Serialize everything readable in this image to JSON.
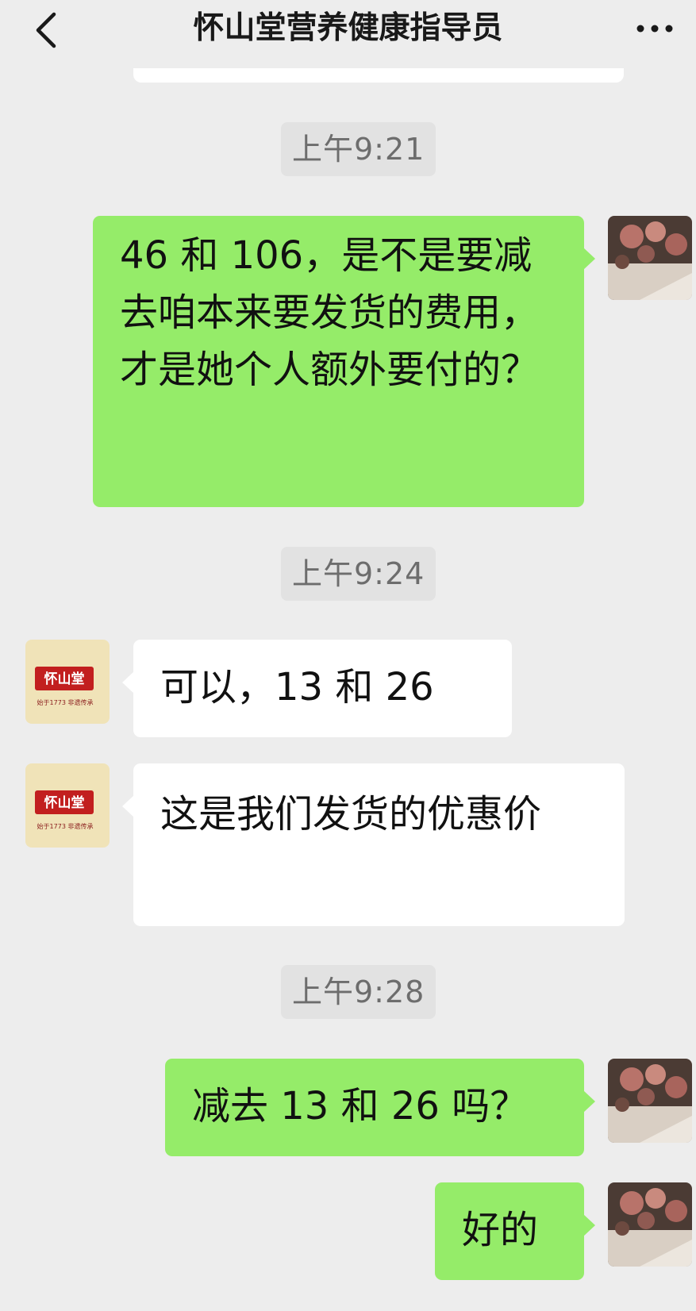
{
  "header": {
    "title": "怀山堂营养健康指导员",
    "back_icon": "chevron-left-icon",
    "more_icon": "more-dots-icon"
  },
  "messages": [
    {
      "type": "time",
      "text": "上午9:21"
    },
    {
      "type": "sent",
      "text": "46 和 106，是不是要减去咱本来要发货的费用，才是她个人额外要付的？"
    },
    {
      "type": "time",
      "text": "上午9:24"
    },
    {
      "type": "received",
      "text": "可以，13 和 26"
    },
    {
      "type": "received",
      "text": "这是我们发货的优惠价"
    },
    {
      "type": "time",
      "text": "上午9:28"
    },
    {
      "type": "sent",
      "text": "减去 13 和 26 吗？"
    },
    {
      "type": "sent",
      "text": "好的"
    }
  ],
  "contact_avatar": {
    "logo_text": "怀山堂",
    "tagline": "始于1773 非遗传承"
  },
  "colors": {
    "background": "#ededed",
    "sent_bubble": "#95ec69",
    "received_bubble": "#ffffff",
    "time_badge": "#e2e2e2"
  }
}
